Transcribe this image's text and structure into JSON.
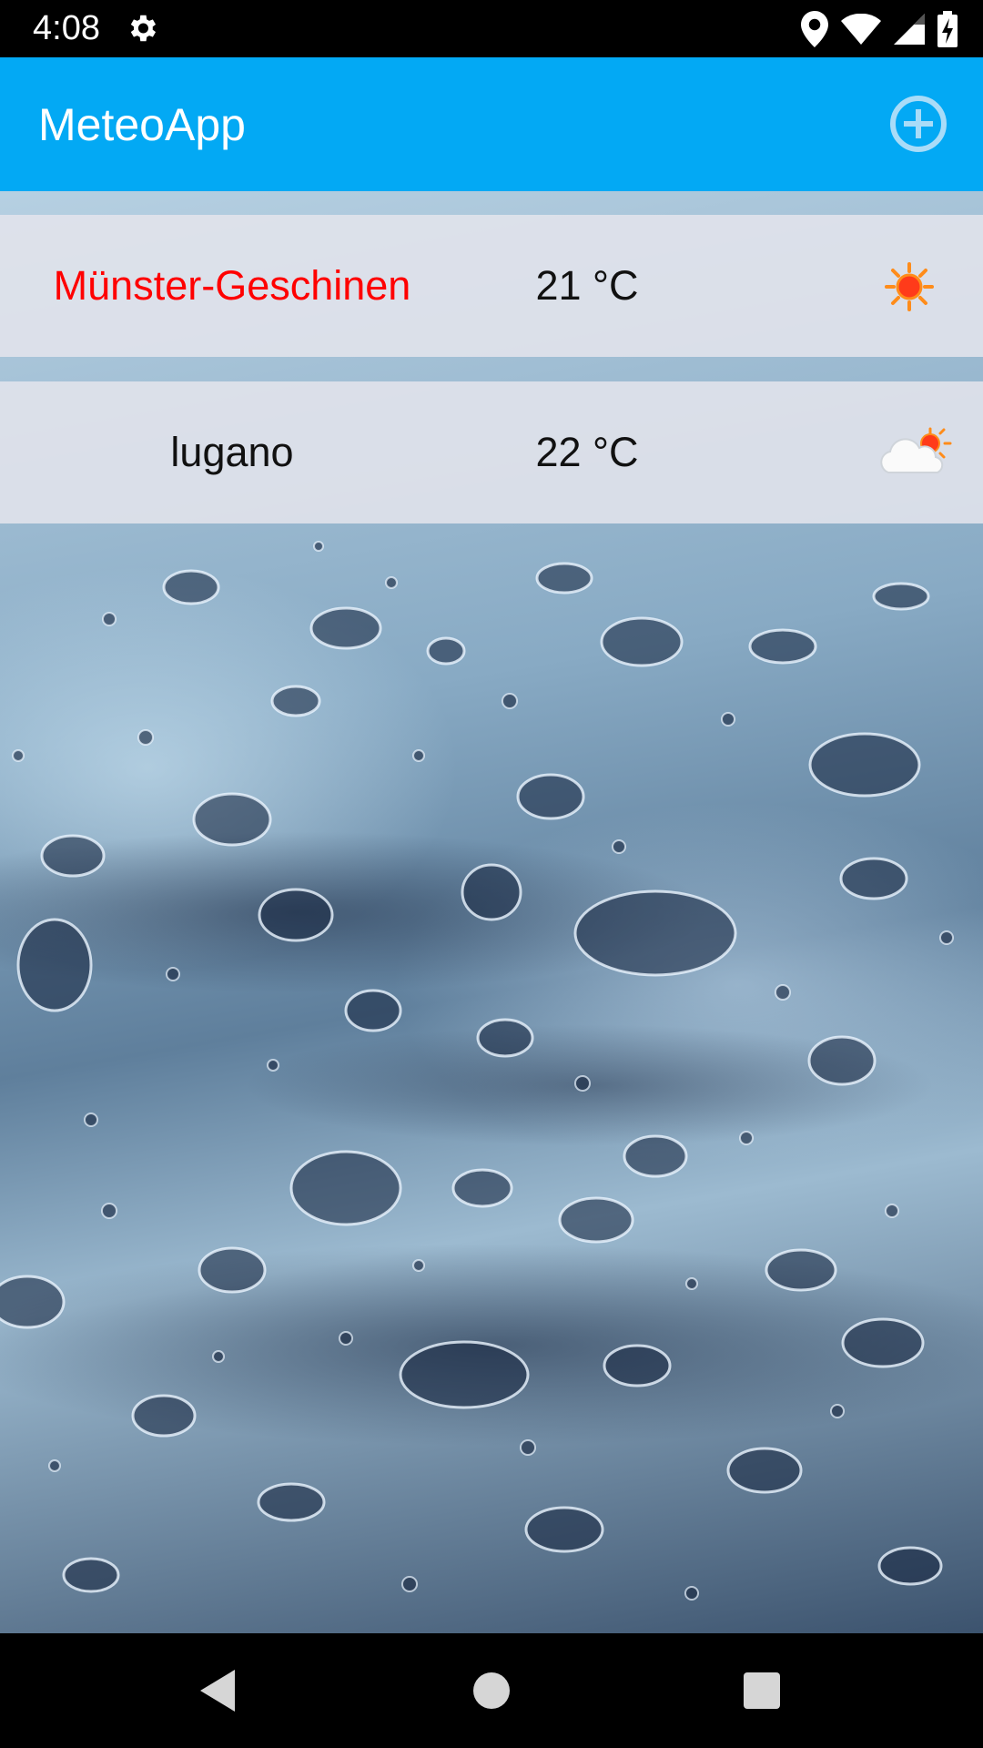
{
  "status_bar": {
    "time": "4:08",
    "icons": [
      "settings-gear-icon",
      "location-pin-icon",
      "wifi-icon",
      "cell-signal-icon",
      "battery-charging-icon"
    ]
  },
  "app_bar": {
    "title": "MeteoApp",
    "add_icon": "add-circle-icon",
    "color": "#03a9f4"
  },
  "cities": [
    {
      "name": "Münster-Geschinen",
      "temperature": "21 °C",
      "weather_icon": "sun-icon",
      "name_color": "#ff0000"
    },
    {
      "name": "lugano",
      "temperature": "22 °C",
      "weather_icon": "partly-cloudy-icon",
      "name_color": "#111111"
    }
  ],
  "navigation_bar": {
    "buttons": [
      "back-icon",
      "home-icon",
      "recents-icon"
    ]
  }
}
